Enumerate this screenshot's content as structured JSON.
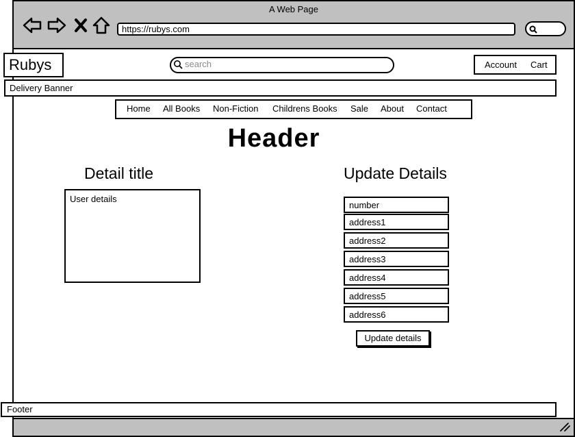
{
  "browser": {
    "window_title": "A Web Page",
    "url": "https://rubys.com",
    "icons": [
      "back-icon",
      "forward-icon",
      "stop-icon",
      "home-icon",
      "search-icon",
      "resize-grip-icon"
    ]
  },
  "site": {
    "logo": "Rubys",
    "search_placeholder": "search",
    "account": "Account",
    "cart": "Cart",
    "delivery_banner": "Delivery Banner"
  },
  "nav": {
    "items": [
      "Home",
      "All Books",
      "Non-Fiction",
      "Childrens Books",
      "Sale",
      "About",
      "Contact"
    ]
  },
  "main": {
    "header": "Header",
    "detail_title": "Detail title",
    "user_details": "User details",
    "update_title": "Update Details",
    "fields": [
      "number",
      "address1",
      "address2",
      "address3",
      "address4",
      "address5",
      "address6"
    ],
    "update_button": "Update details"
  },
  "footer": {
    "label": "Footer"
  }
}
